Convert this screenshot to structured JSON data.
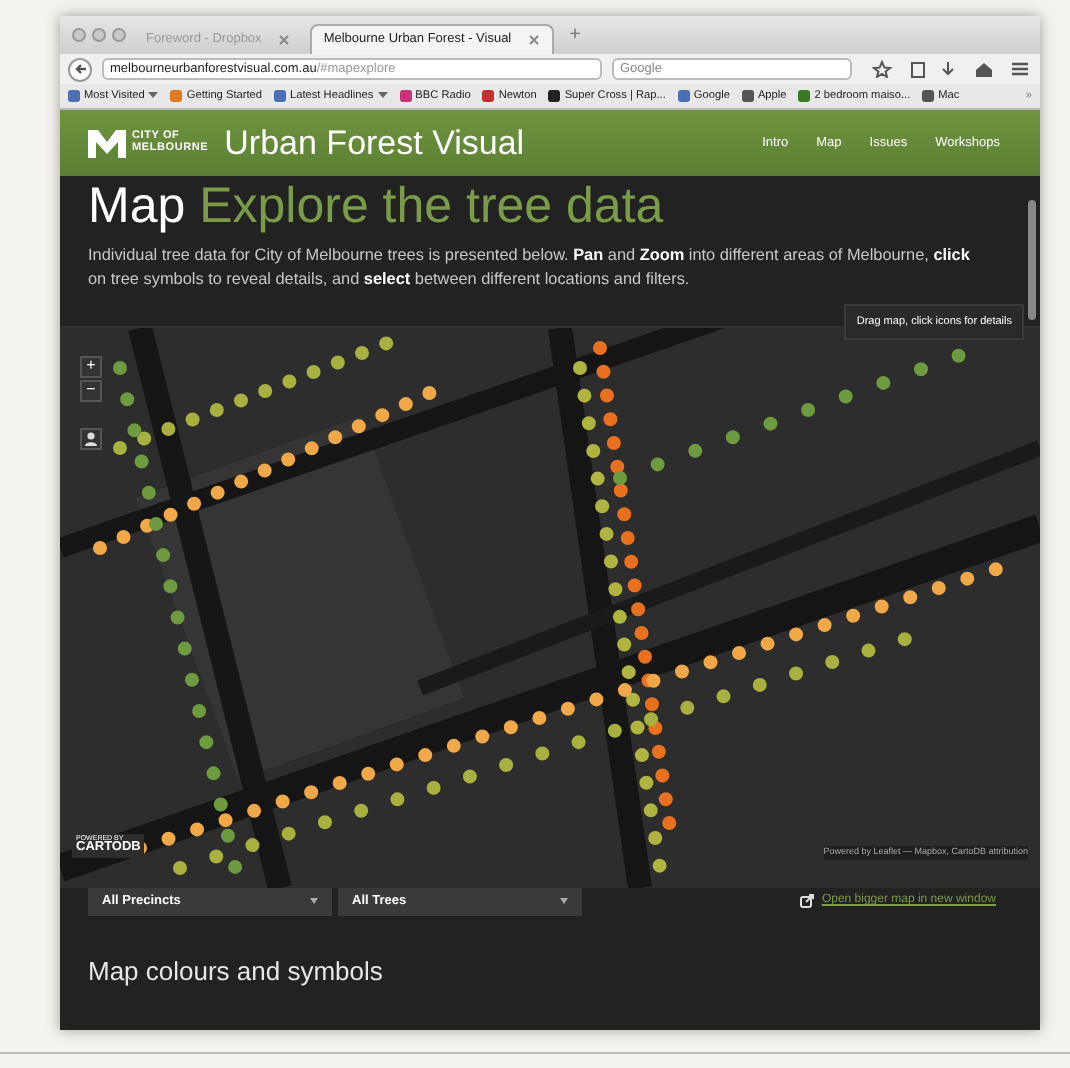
{
  "browser": {
    "tabs": [
      {
        "label": "Foreword - Dropbox",
        "selected": false
      },
      {
        "label": "Melbourne Urban Forest - Visual",
        "selected": true
      }
    ],
    "new_tab": "+",
    "url": {
      "host": "melbourneurbanforestvisual.com.au",
      "path": "/#mapexplore"
    },
    "search": {
      "placeholder": "Google"
    },
    "bookmarks": [
      {
        "label": "Most Visited",
        "dropdown": true,
        "color": "#4a6fb5"
      },
      {
        "label": "Getting Started",
        "dropdown": false,
        "color": "#e07a20"
      },
      {
        "label": "Latest Headlines",
        "dropdown": true,
        "color": "#4a6fb5"
      },
      {
        "label": "BBC Radio",
        "dropdown": false,
        "color": "#d0307a"
      },
      {
        "label": "Newton",
        "dropdown": false,
        "color": "#c03030"
      },
      {
        "label": "Super Cross | Rap...",
        "dropdown": false,
        "color": "#222222"
      },
      {
        "label": "Google",
        "dropdown": false,
        "color": "#4a6fb5"
      },
      {
        "label": "Apple",
        "dropdown": false,
        "color": "#555555"
      },
      {
        "label": "2 bedroom maiso...",
        "dropdown": false,
        "color": "#3a7a20"
      },
      {
        "label": "Mac",
        "dropdown": false,
        "color": "#555555"
      }
    ],
    "bookmarks_more": "»"
  },
  "site": {
    "logo": {
      "line1": "CITY OF",
      "line2": "MELBOURNE"
    },
    "title": "Urban Forest Visual",
    "nav": [
      {
        "label": "Intro"
      },
      {
        "label": "Map"
      },
      {
        "label": "Issues"
      },
      {
        "label": "Workshops"
      }
    ]
  },
  "page": {
    "heading": "Map",
    "subheading": "Explore the tree data",
    "intro": "Individual tree data for City of Melbourne trees is presented below. **Pan** and **Zoom** into different areas of Melbourne, **click** on tree symbols to reveal details, and **select** between different locations and filters.",
    "map": {
      "tooltip": "Drag map, click icons for details",
      "zoom_in": "+",
      "zoom_out": "−",
      "powered_by": "POWERED BY",
      "logo": "CARTODB",
      "attribution": "Powered by Leaflet — Mapbox, CartoDB attribution"
    },
    "filters": [
      {
        "value": "All Precincts"
      },
      {
        "value": "All Trees"
      }
    ],
    "link": "Open bigger map in new window",
    "section_heading": "Map colours and symbols"
  }
}
